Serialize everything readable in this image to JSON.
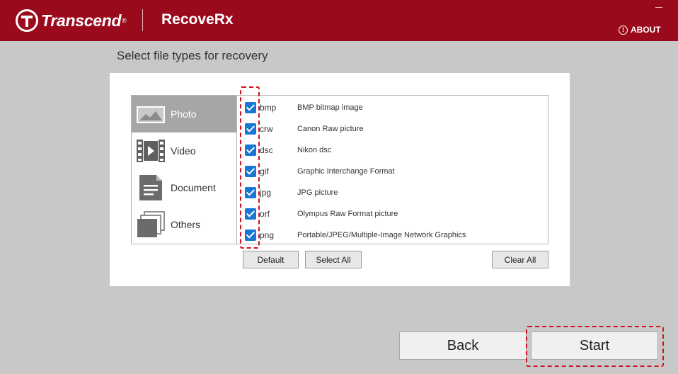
{
  "header": {
    "brand": "Transcend",
    "brand_mark": "®",
    "app_name": "RecoveRx",
    "about_label": "ABOUT",
    "background_color": "#9b0a1c"
  },
  "page": {
    "title": "Select file types for recovery"
  },
  "categories": [
    {
      "label": "Photo",
      "icon": "photo-icon",
      "active": true
    },
    {
      "label": "Video",
      "icon": "video-icon",
      "active": false
    },
    {
      "label": "Document",
      "icon": "document-icon",
      "active": false
    },
    {
      "label": "Others",
      "icon": "others-icon",
      "active": false
    }
  ],
  "file_types": [
    {
      "ext": "bmp",
      "desc": "BMP bitmap image",
      "checked": true
    },
    {
      "ext": "crw",
      "desc": "Canon Raw picture",
      "checked": true
    },
    {
      "ext": "dsc",
      "desc": "Nikon dsc",
      "checked": true
    },
    {
      "ext": "gif",
      "desc": "Graphic Interchange Format",
      "checked": true
    },
    {
      "ext": "jpg",
      "desc": "JPG picture",
      "checked": true
    },
    {
      "ext": "orf",
      "desc": "Olympus Raw Format picture",
      "checked": true
    },
    {
      "ext": "png",
      "desc": "Portable/JPEG/Multiple-Image Network Graphics",
      "checked": true
    }
  ],
  "buttons": {
    "default": "Default",
    "select_all": "Select All",
    "clear_all": "Clear All",
    "back": "Back",
    "start": "Start"
  },
  "colors": {
    "checkbox": "#1976d2",
    "highlight": "#d0111e",
    "active_category": "#a6a6a6"
  }
}
